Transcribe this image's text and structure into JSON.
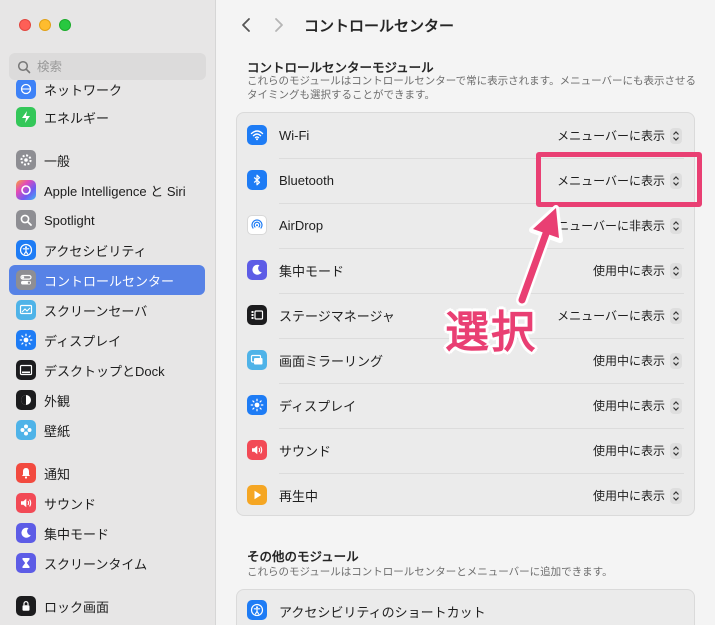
{
  "sidebar": {
    "search_placeholder": "検索",
    "items": [
      {
        "label": "ネットワーク",
        "icon": "network-icon",
        "color": "#3e82f7"
      },
      {
        "label": "エネルギー",
        "icon": "battery-bolt-icon",
        "color": "#34c759"
      },
      {
        "label": "一般",
        "icon": "gear-icon",
        "color": "#8e8e93"
      },
      {
        "label": "Apple Intelligence と Siri",
        "icon": "siri-icon",
        "color": "#d04fe6"
      },
      {
        "label": "Spotlight",
        "icon": "magnifier-icon",
        "color": "#8e8e93"
      },
      {
        "label": "アクセシビリティ",
        "icon": "accessibility-icon",
        "color": "#1e7cf5"
      },
      {
        "label": "コントロールセンター",
        "icon": "control-center-icon",
        "color": "#8e8e93"
      },
      {
        "label": "スクリーンセーバ",
        "icon": "screensaver-icon",
        "color": "#4fb3e8"
      },
      {
        "label": "ディスプレイ",
        "icon": "sun-icon",
        "color": "#1e7cf5"
      },
      {
        "label": "デスクトップとDock",
        "icon": "dock-icon",
        "color": "#1c1c1e"
      },
      {
        "label": "外観",
        "icon": "appearance-icon",
        "color": "#1c1c1e"
      },
      {
        "label": "壁紙",
        "icon": "wallpaper-icon",
        "color": "#4fb3e8"
      },
      {
        "label": "通知",
        "icon": "bell-icon",
        "color": "#f24a3f"
      },
      {
        "label": "サウンド",
        "icon": "speaker-icon",
        "color": "#f24a56"
      },
      {
        "label": "集中モード",
        "icon": "moon-icon",
        "color": "#5d5ce6"
      },
      {
        "label": "スクリーンタイム",
        "icon": "hourglass-icon",
        "color": "#5d5ce6"
      },
      {
        "label": "ロック画面",
        "icon": "lock-screen-icon",
        "color": "#1c1c1e"
      }
    ]
  },
  "toolbar": {
    "title": "コントロールセンター"
  },
  "modules": {
    "title": "コントロールセンターモジュール",
    "desc": "これらのモジュールはコントロールセンターで常に表示されます。メニューバーにも表示させるタイミングも選択することができます。",
    "rows": [
      {
        "label": "Wi-Fi",
        "value": "メニューバーに表示",
        "icon": "wifi-icon",
        "color": "#1e7cf5"
      },
      {
        "label": "Bluetooth",
        "value": "メニューバーに表示",
        "icon": "bluetooth-icon",
        "color": "#1e7cf5"
      },
      {
        "label": "AirDrop",
        "value": "メニューバーに非表示",
        "icon": "airdrop-icon",
        "color": "#ffffff"
      },
      {
        "label": "集中モード",
        "value": "使用中に表示",
        "icon": "moon-icon",
        "color": "#5d5ce6"
      },
      {
        "label": "ステージマネージャ",
        "value": "メニューバーに表示",
        "icon": "stage-manager-icon",
        "color": "#1c1c1e"
      },
      {
        "label": "画面ミラーリング",
        "value": "使用中に表示",
        "icon": "screen-mirroring-icon",
        "color": "#4fb3e8"
      },
      {
        "label": "ディスプレイ",
        "value": "使用中に表示",
        "icon": "sun-icon",
        "color": "#1e7cf5"
      },
      {
        "label": "サウンド",
        "value": "使用中に表示",
        "icon": "speaker-icon",
        "color": "#f24a56"
      },
      {
        "label": "再生中",
        "value": "使用中に表示",
        "icon": "play-icon",
        "color": "#f5a623"
      }
    ]
  },
  "other": {
    "title": "その他のモジュール",
    "desc": "これらのモジュールはコントロールセンターとメニューバーに追加できます。",
    "rows": [
      {
        "label": "アクセシビリティのショートカット",
        "icon": "accessibility-icon",
        "color": "#1e7cf5"
      }
    ]
  },
  "annotation": {
    "text": "選択",
    "color": "#e93f73"
  }
}
